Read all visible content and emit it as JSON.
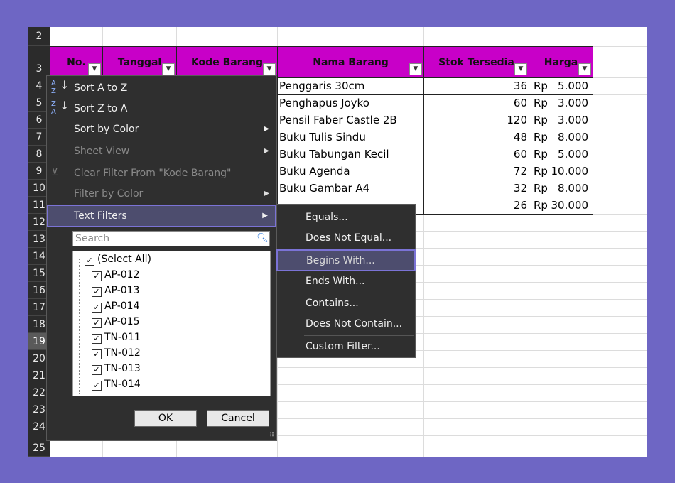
{
  "row_numbers": [
    "2",
    "3",
    "4",
    "5",
    "6",
    "7",
    "8",
    "9",
    "10",
    "11",
    "12",
    "13",
    "14",
    "15",
    "16",
    "17",
    "18",
    "19",
    "20",
    "21",
    "22",
    "23",
    "24",
    "25"
  ],
  "selected_row": "19",
  "headers": [
    "No.",
    "Tanggal",
    "Kode Barang",
    "Nama Barang",
    "Stok Tersedia",
    "Harga"
  ],
  "rows": [
    {
      "nama": "Penggaris 30cm",
      "stok": "36",
      "rp": "Rp",
      "harga": "5.000"
    },
    {
      "nama": "Penghapus Joyko",
      "stok": "60",
      "rp": "Rp",
      "harga": "3.000"
    },
    {
      "nama": "Pensil Faber Castle 2B",
      "stok": "120",
      "rp": "Rp",
      "harga": "3.000"
    },
    {
      "nama": "Buku Tulis Sindu",
      "stok": "48",
      "rp": "Rp",
      "harga": "8.000"
    },
    {
      "nama": "Buku Tabungan Kecil",
      "stok": "60",
      "rp": "Rp",
      "harga": "5.000"
    },
    {
      "nama": "Buku Agenda",
      "stok": "72",
      "rp": "Rp",
      "harga": "10.000"
    },
    {
      "nama": "Buku Gambar A4",
      "stok": "32",
      "rp": "Rp",
      "harga": "8.000"
    },
    {
      "nama": "",
      "stok": "26",
      "rp": "Rp",
      "harga": "30.000"
    }
  ],
  "filter_menu": {
    "sort_az": "Sort A to Z",
    "sort_za": "Sort Z to A",
    "sort_color": "Sort by Color",
    "sheet_view": "Sheet View",
    "clear_filter": "Clear Filter From \"Kode Barang\"",
    "filter_color": "Filter by Color",
    "text_filters": "Text Filters",
    "search_placeholder": "Search",
    "items": [
      "(Select All)",
      "AP-012",
      "AP-013",
      "AP-014",
      "AP-015",
      "TN-011",
      "TN-012",
      "TN-013",
      "TN-014"
    ],
    "ok": "OK",
    "cancel": "Cancel"
  },
  "text_filters_menu": {
    "equals": "Equals...",
    "not_equal": "Does Not Equal...",
    "begins_with": "Begins With...",
    "ends_with": "Ends With...",
    "contains": "Contains...",
    "not_contain": "Does Not Contain...",
    "custom": "Custom Filter..."
  },
  "colors": {
    "header_fill": "#c800c8",
    "background": "#6e66c4",
    "menu_bg": "#2f2f2f",
    "highlight_border": "#7b73d6"
  }
}
